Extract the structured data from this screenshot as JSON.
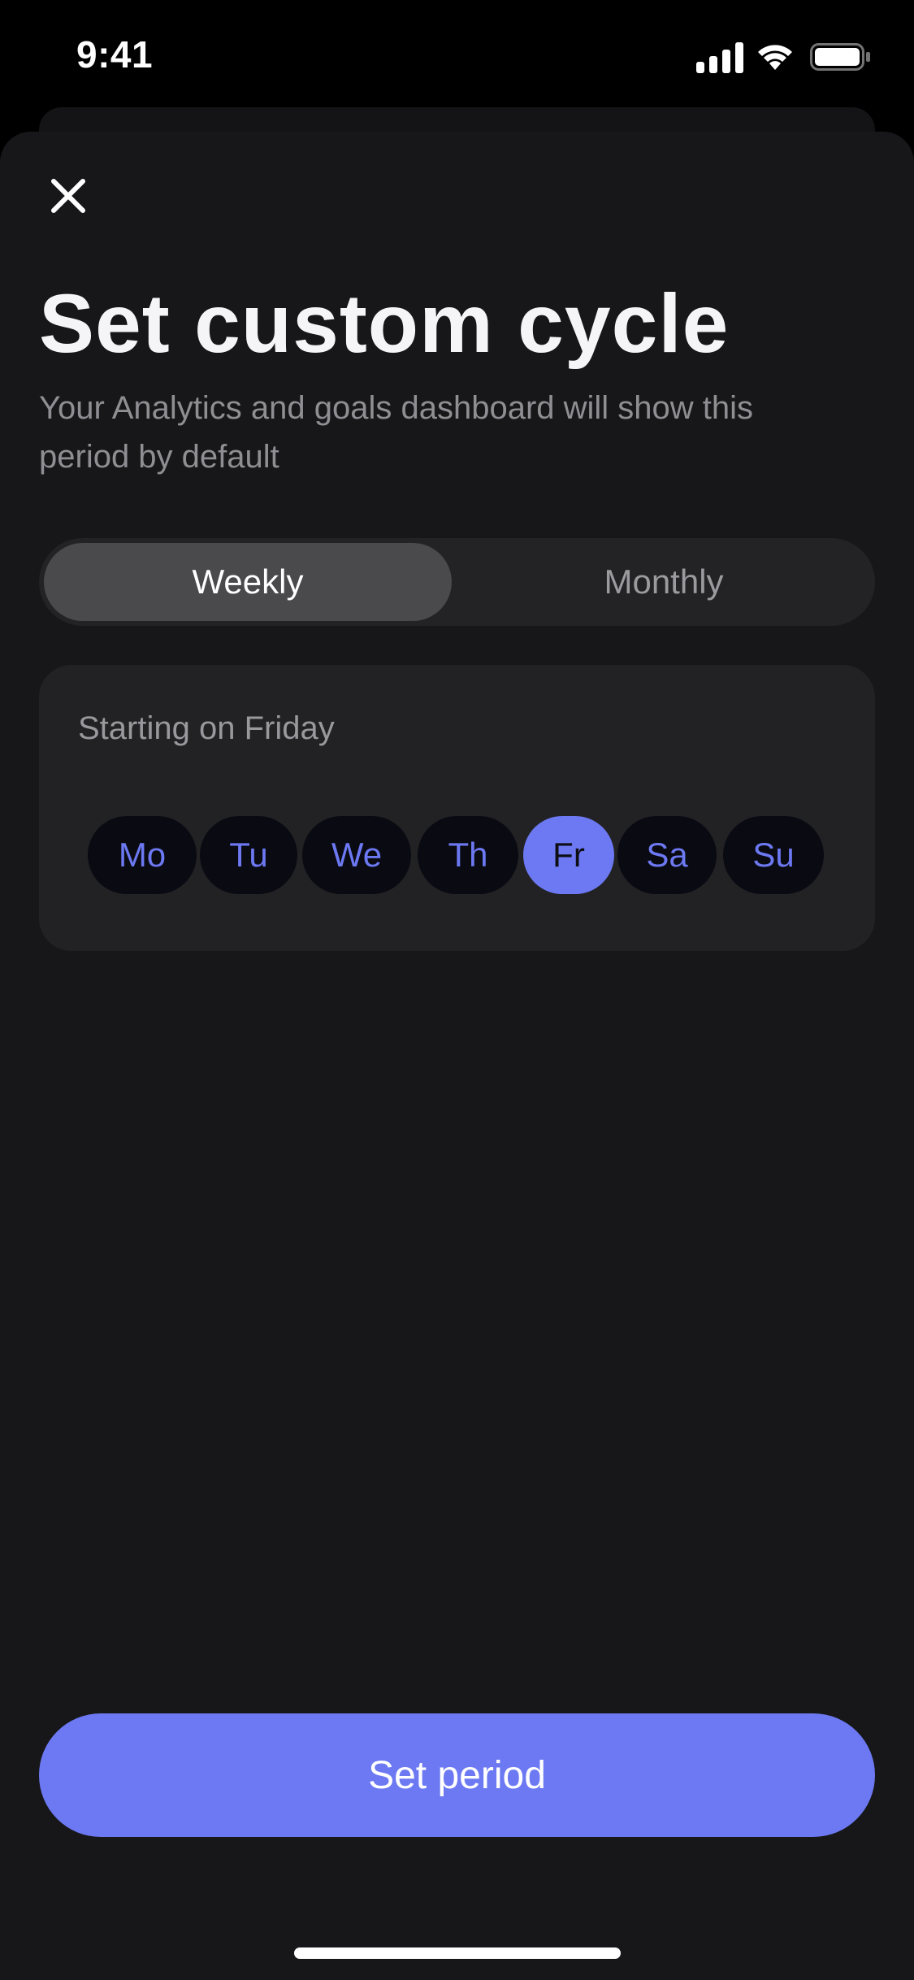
{
  "status_bar": {
    "time": "9:41",
    "icons": [
      "cellular-signal-icon",
      "wifi-icon",
      "battery-icon"
    ]
  },
  "sheet": {
    "close_icon": "close-icon",
    "title": "Set custom cycle",
    "subtitle": "Your Analytics and goals dashboard will show this period by default"
  },
  "period_toggle": {
    "options": [
      "Weekly",
      "Monthly"
    ],
    "selected": "Weekly"
  },
  "day_picker": {
    "label": "Starting on Friday",
    "days": [
      "Mo",
      "Tu",
      "We",
      "Th",
      "Fr",
      "Sa",
      "Su"
    ],
    "selected": "Fr"
  },
  "primary_action": {
    "label": "Set period"
  },
  "colors": {
    "accent": "#6c79f2",
    "sheet_background": "#17171a",
    "card_background": "#222225",
    "muted_text": "#8e8e93"
  }
}
